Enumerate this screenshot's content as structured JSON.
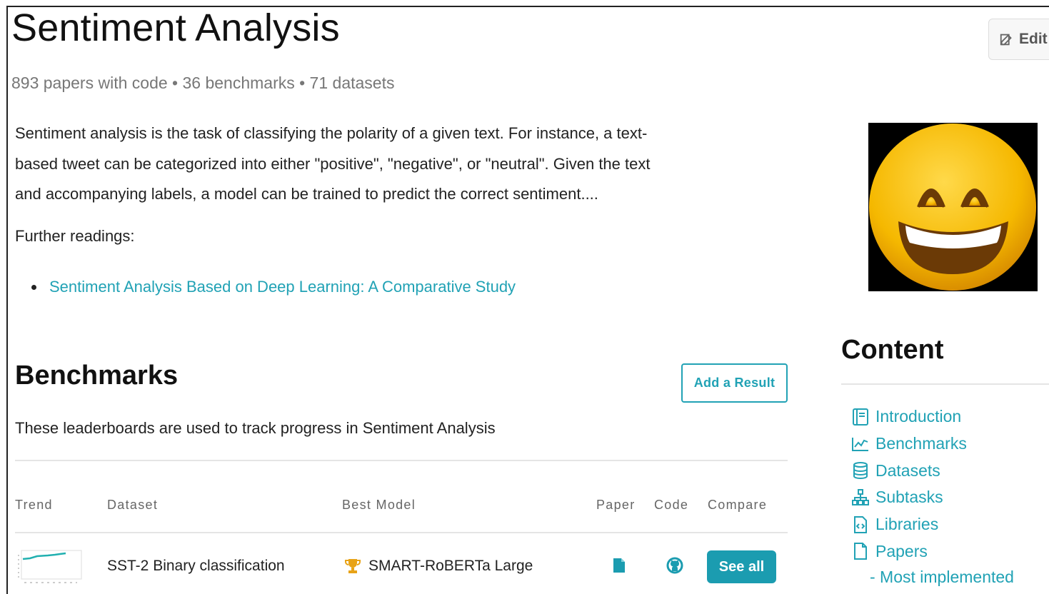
{
  "header": {
    "title": "Sentiment Analysis",
    "edit_label": "Edit",
    "stats": "893 papers with code • 36 benchmarks • 71 datasets"
  },
  "intro": {
    "line1": "Sentiment analysis is the task of classifying the polarity of a given text. For instance, a text-",
    "line2": "based tweet can be categorized into either \"positive\", \"negative\", or \"neutral\". Given the text",
    "line3": "and accompanying labels, a model can be trained to predict the correct sentiment....",
    "further_label": "Further readings:",
    "readings": [
      "Sentiment Analysis Based on Deep Learning: A Comparative Study"
    ]
  },
  "benchmarks": {
    "title": "Benchmarks",
    "add_result_label": "Add a Result",
    "description": "These leaderboards are used to track progress in Sentiment Analysis",
    "columns": [
      "Trend",
      "Dataset",
      "Best Model",
      "Paper",
      "Code",
      "Compare"
    ],
    "rows": [
      {
        "dataset": "SST-2 Binary classification",
        "best_model": "SMART-RoBERTa Large",
        "compare_label": "See all"
      }
    ]
  },
  "sidebar": {
    "content_title": "Content",
    "items": [
      {
        "label": "Introduction",
        "icon": "book-icon"
      },
      {
        "label": "Benchmarks",
        "icon": "chart-icon"
      },
      {
        "label": "Datasets",
        "icon": "database-icon"
      },
      {
        "label": "Subtasks",
        "icon": "hierarchy-icon"
      },
      {
        "label": "Libraries",
        "icon": "code-file-icon"
      },
      {
        "label": "Papers",
        "icon": "file-icon"
      }
    ],
    "sub_item": "- Most implemented"
  },
  "colors": {
    "accent": "#21a2b5",
    "button": "#1b9cb0",
    "emoji_face": "#f5b800",
    "text": "#222222",
    "muted": "#777777"
  }
}
